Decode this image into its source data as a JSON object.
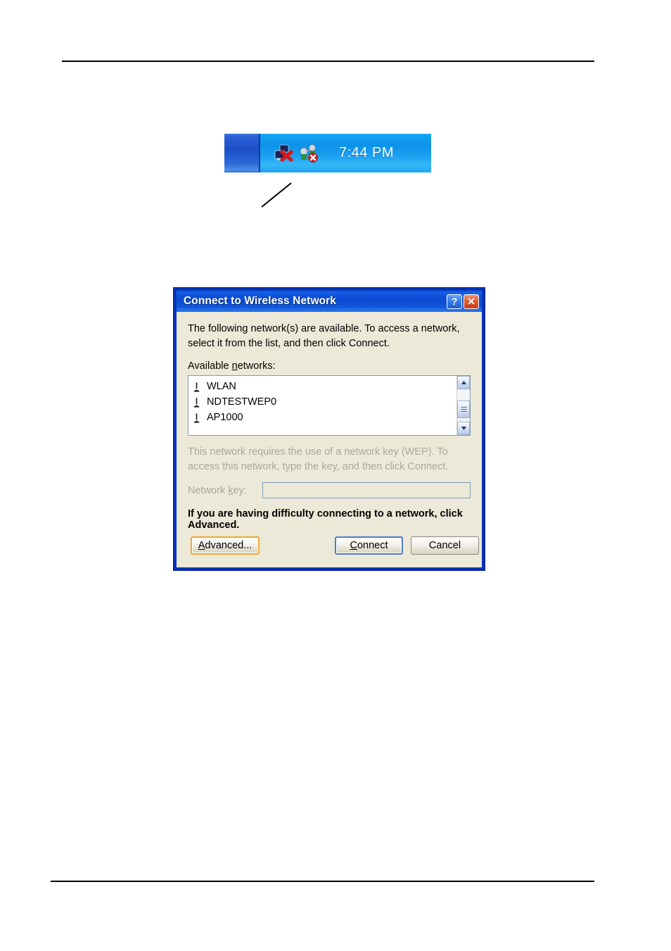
{
  "taskbar": {
    "clock": "7:44 PM",
    "icons": [
      {
        "name": "network-disconnected-icon",
        "label": "Network connection disconnected"
      },
      {
        "name": "wireless-network-disabled-icon",
        "label": "Wireless network connection unavailable"
      }
    ]
  },
  "annotation": {
    "leader_line": "leader-line-pointer"
  },
  "dialog": {
    "title": "Connect to Wireless Network",
    "titlebar_buttons": [
      {
        "name": "help-button",
        "glyph": "?"
      },
      {
        "name": "close-button",
        "glyph": "✕"
      }
    ],
    "intro": "The following network(s) are available. To access a network, select it from the list, and then click Connect.",
    "available_label_pre": "Available ",
    "available_label_key": "n",
    "available_label_post": "etworks:",
    "networks": [
      {
        "ssid": "WLAN",
        "icon": "access-point-icon"
      },
      {
        "ssid": "NDTESTWEP0",
        "icon": "access-point-icon"
      },
      {
        "ssid": "AP1000",
        "icon": "access-point-icon"
      }
    ],
    "wep_notice": "This network requires the use of a network key (WEP). To access this network, type the key, and then click Connect.",
    "network_key": {
      "label_pre": "Network ",
      "label_key": "k",
      "label_post": "ey:",
      "value": "",
      "placeholder": "",
      "enabled": false
    },
    "hint_pre": "If you are having difficulty connecting to a network, click Advanced.",
    "buttons": {
      "advanced_pre": "",
      "advanced_key": "A",
      "advanced_post": "dvanced...",
      "connect_pre": "",
      "connect_key": "C",
      "connect_post": "onnect",
      "cancel": "Cancel"
    },
    "colors": {
      "titlebar_blue": "#0c4ad0",
      "frame_blue": "#0831b5",
      "dialog_face": "#ece9d8",
      "disabled_text": "#aca899",
      "focus_orange": "#f0a830",
      "default_blue": "#4f7bc9",
      "close_red": "#c7391a"
    }
  }
}
